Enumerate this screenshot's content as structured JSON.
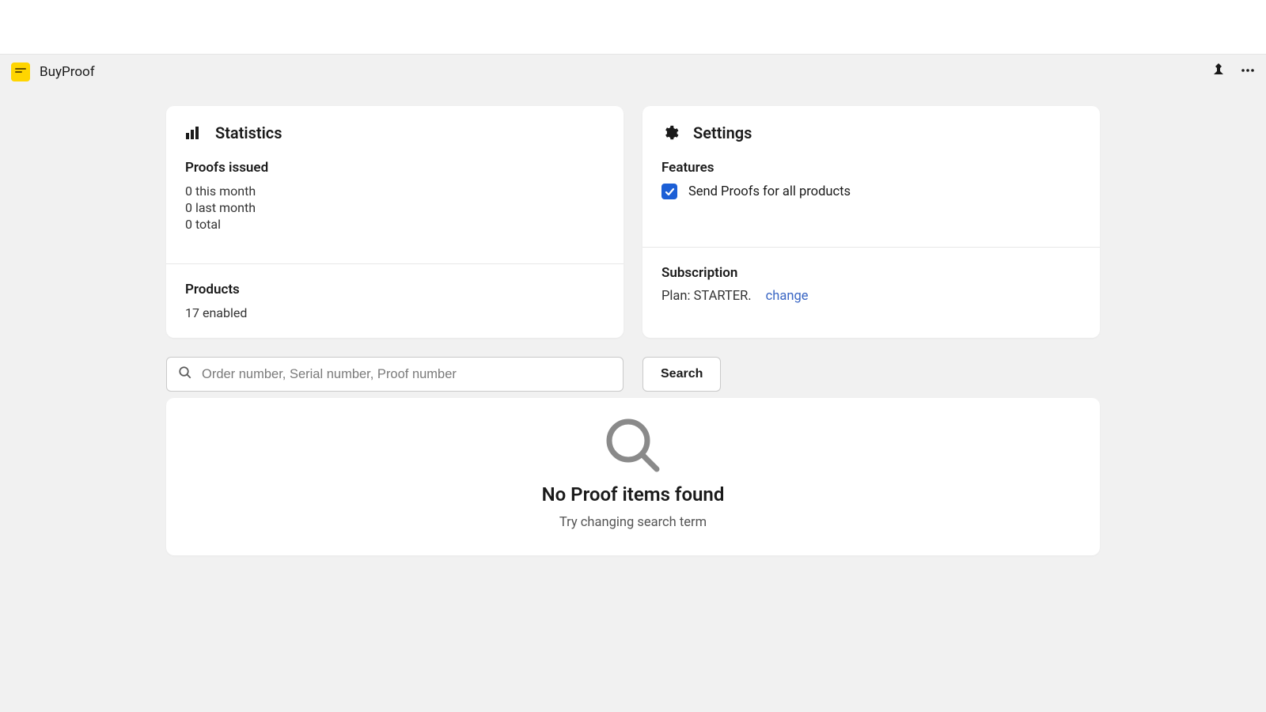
{
  "app": {
    "title": "BuyProof"
  },
  "statistics": {
    "title": "Statistics",
    "proofs_heading": "Proofs issued",
    "lines": {
      "this_month": "0 this month",
      "last_month": "0 last month",
      "total": "0 total"
    },
    "products_heading": "Products",
    "products_value": "17 enabled"
  },
  "settings": {
    "title": "Settings",
    "features_heading": "Features",
    "feature_send_proofs": {
      "label": "Send Proofs for all products",
      "checked": true
    },
    "subscription_heading": "Subscription",
    "plan_text": "Plan: STARTER.",
    "change_label": "change"
  },
  "search": {
    "placeholder": "Order number, Serial number, Proof number",
    "button_label": "Search"
  },
  "empty_state": {
    "title": "No Proof items found",
    "subtitle": "Try changing search term"
  }
}
